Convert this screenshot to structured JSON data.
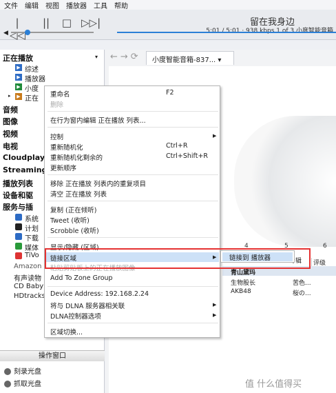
{
  "menubar": [
    "文件",
    "编辑",
    "视图",
    "播放器",
    "工具",
    "帮助"
  ],
  "transport": {
    "prev": "|◁◁",
    "pause": "||",
    "stop": "□",
    "next": "▷▷|",
    "title": "留在我身边",
    "stats": "5:01 / 5:01 · 938 kbps  1 of 3  小度智能音箱"
  },
  "sidebar": {
    "now_playing": "正在播放",
    "np_items": [
      "综述",
      "播放器",
      "小度",
      "正在"
    ],
    "groups": [
      "音频",
      "图像",
      "视频",
      "电视",
      "Cloudplay",
      "Streaming",
      "播放列表",
      "设备和驱",
      "服务与插"
    ],
    "services": [
      "系统",
      "计划",
      "下载",
      "媒体",
      "TiVo",
      "Amazon",
      "有声读物",
      "CD Baby",
      "HDtracks"
    ],
    "ops_header": "操作窗口",
    "ops": [
      "刻录光盘",
      "抓取光盘"
    ]
  },
  "tab": {
    "label": "小度智能音箱-837... ▾"
  },
  "nav": "←→⟳",
  "columns": [
    "4",
    "5",
    "6"
  ],
  "grid_header": [
    "专辑",
    "评级"
  ],
  "rows": [
    [
      "青山黛玛",
      ""
    ],
    [
      "生物股长",
      "苦色..."
    ],
    [
      "AKB48",
      "桜の..."
    ]
  ],
  "menu": {
    "items": [
      {
        "label": "重命名",
        "shortcut": "F2"
      },
      {
        "label": "删除",
        "disabled": true
      },
      {
        "label": "在行为窗内编辑 正在播放 列表..."
      },
      {
        "label": "控制",
        "arrow": true
      },
      {
        "label": "重新随机化",
        "shortcut": "Ctrl+R"
      },
      {
        "label": "重新随机化剩余的",
        "shortcut": "Ctrl+Shift+R"
      },
      {
        "label": "更新顺序"
      },
      {
        "label": "移除 正在播放 列表内的重复项目"
      },
      {
        "label": "清空 正在播放 列表"
      },
      {
        "label": "复制 (正在倾听)"
      },
      {
        "label": "Tweet (收听)"
      },
      {
        "label": "Scrobble (收听)"
      },
      {
        "label": "显示/隐藏 (区域)"
      },
      {
        "label": "链接区域",
        "arrow": true
      },
      {
        "label": "粘贴剪贴板上的正在播放图像",
        "disabled": true
      },
      {
        "label": "Add To Zone Group"
      },
      {
        "label": "Device Address: 192.168.2.24"
      },
      {
        "label": "将与 DLNA 服务器相关联",
        "arrow": true
      },
      {
        "label": "DLNA控制器选项",
        "arrow": true
      },
      {
        "label": "区域切换..."
      }
    ],
    "submenu_item": "链接到 播放器"
  },
  "brand": "值 什么值得买"
}
